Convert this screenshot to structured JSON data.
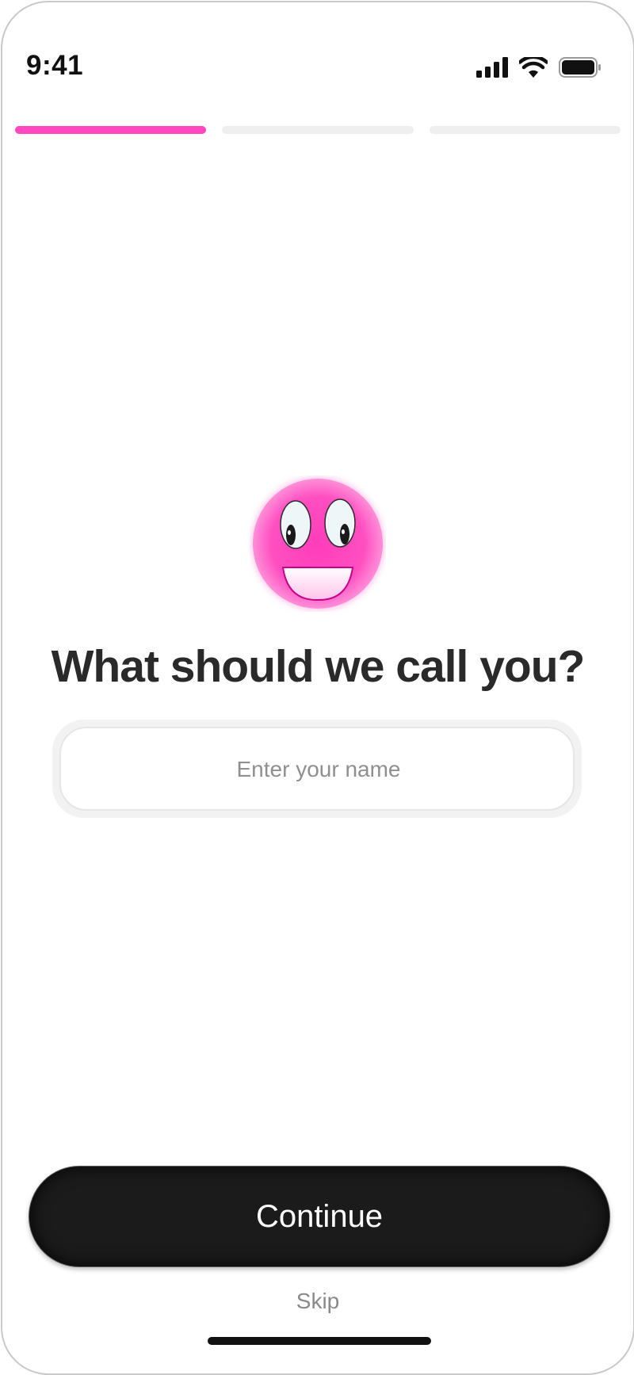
{
  "status_bar": {
    "time": "9:41",
    "icons": [
      "cellular-signal-icon",
      "wifi-icon",
      "battery-icon"
    ]
  },
  "progress": {
    "total_steps": 3,
    "current_step": 1,
    "active_color": "#ff47bf",
    "inactive_color": "#efefef"
  },
  "mascot": {
    "icon": "smiling-face-icon",
    "color": "#ff47bf"
  },
  "main": {
    "title": "What should we call you?",
    "name_input": {
      "placeholder": "Enter your name",
      "value": ""
    }
  },
  "actions": {
    "continue_label": "Continue",
    "skip_label": "Skip"
  }
}
